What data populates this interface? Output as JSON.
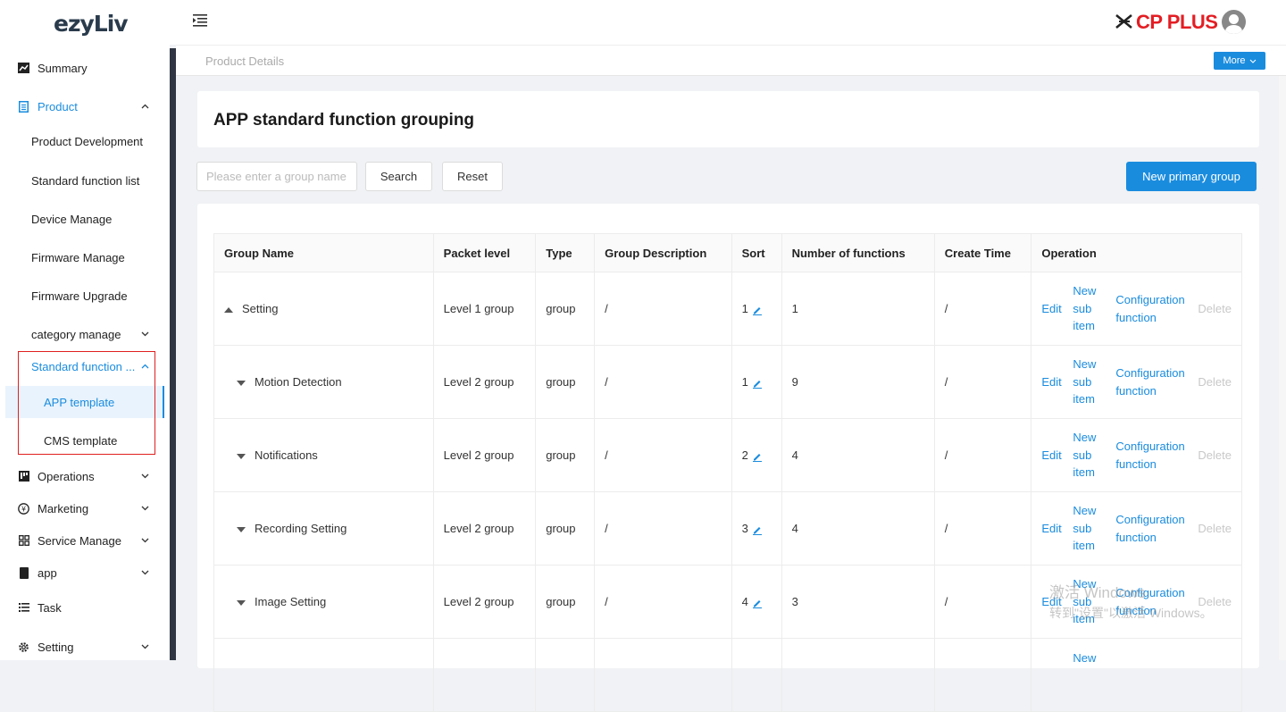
{
  "app": {
    "logo": "ezyLiv",
    "brand": "CP PLUS"
  },
  "sidebar": {
    "summary": "Summary",
    "product": "Product",
    "product_items": [
      "Product Development",
      "Standard function list",
      "Device Manage",
      "Firmware Manage",
      "Firmware Upgrade",
      "category manage"
    ],
    "standard_function": "Standard function ...",
    "standard_function_items": [
      "APP template",
      "CMS template"
    ],
    "operations": "Operations",
    "marketing": "Marketing",
    "service_manage": "Service Manage",
    "app": "app",
    "task": "Task",
    "setting": "Setting"
  },
  "breadcrumb": "Product Details",
  "more_label": "More",
  "page_title": "APP standard function grouping",
  "search": {
    "placeholder": "Please enter a group name",
    "value": "",
    "search_label": "Search",
    "reset_label": "Reset"
  },
  "new_primary_group_label": "New primary group",
  "table": {
    "columns": [
      "Group Name",
      "Packet level",
      "Type",
      "Group Description",
      "Sort",
      "Number of functions",
      "Create Time",
      "Operation"
    ],
    "operations": {
      "edit": "Edit",
      "new_sub": [
        "New",
        "sub",
        "item"
      ],
      "configuration": [
        "Configuration",
        "function"
      ],
      "delete": "Delete"
    },
    "rows": [
      {
        "name": "Setting",
        "level": "Level 1 group",
        "type": "group",
        "desc": "/",
        "sort": "1",
        "count": "1",
        "time": "/",
        "expanded": true
      },
      {
        "name": "Motion Detection",
        "level": "Level 2 group",
        "type": "group",
        "desc": "/",
        "sort": "1",
        "count": "9",
        "time": "/"
      },
      {
        "name": "Notifications",
        "level": "Level 2 group",
        "type": "group",
        "desc": "/",
        "sort": "2",
        "count": "4",
        "time": "/"
      },
      {
        "name": "Recording Setting",
        "level": "Level 2 group",
        "type": "group",
        "desc": "/",
        "sort": "3",
        "count": "4",
        "time": "/"
      },
      {
        "name": "Image Setting",
        "level": "Level 2 group",
        "type": "group",
        "desc": "/",
        "sort": "4",
        "count": "3",
        "time": "/"
      }
    ],
    "partial_row_new": "New"
  },
  "watermark": {
    "line1": "激活 Windows",
    "line2": "转到\"设置\"以激活 Windows。"
  },
  "colors": {
    "accent": "#1a8cde",
    "brand_red": "#e31e24"
  }
}
